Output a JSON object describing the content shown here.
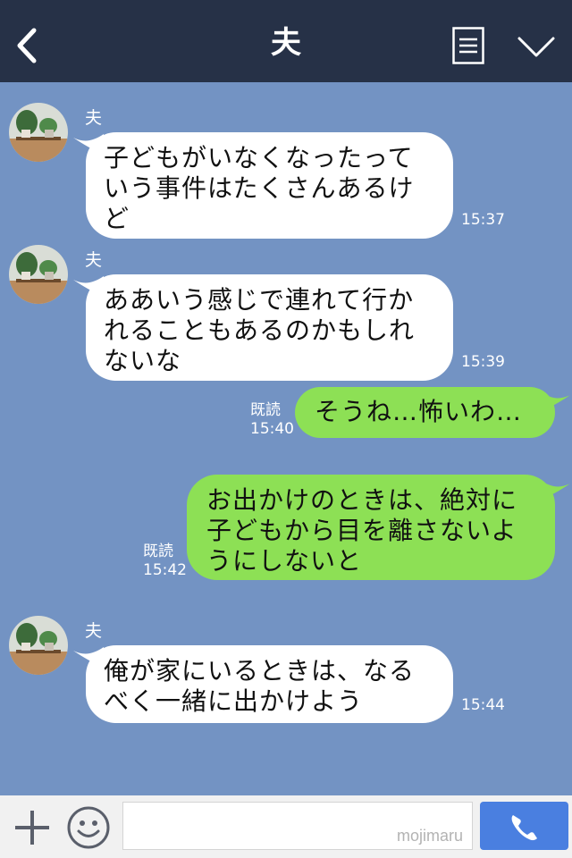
{
  "header": {
    "title": "夫"
  },
  "messages": [
    {
      "side": "in",
      "sender": "夫",
      "lines": [
        "子どもがいなくなったって",
        "いう事件はたくさんあるけ",
        "ど"
      ],
      "time": "15:37"
    },
    {
      "side": "in",
      "sender": "夫",
      "lines": [
        "ああいう感じで連れて行か",
        "れることもあるのかもしれ",
        "ないな"
      ],
      "time": "15:39"
    },
    {
      "side": "out",
      "read": "既読",
      "lines": [
        "そうね…怖いわ…"
      ],
      "time": "15:40"
    },
    {
      "side": "out",
      "read": "既読",
      "lines": [
        "お出かけのときは、絶対に",
        "子どもから目を離さないよ",
        "うにしないと"
      ],
      "time": "15:42"
    },
    {
      "side": "in",
      "sender": "夫",
      "lines": [
        "俺が家にいるときは、なる",
        "べく一緒に出かけよう"
      ],
      "time": "15:44"
    }
  ],
  "footer": {
    "watermark": "mojimaru"
  },
  "colors": {
    "header": "#263147",
    "chat_bg": "#7393c3",
    "incoming": "#ffffff",
    "outgoing": "#8de055",
    "call_button": "#4a7fe0"
  },
  "icons": {
    "back": "chevron-left-icon",
    "menu": "menu-list-icon",
    "collapse": "chevron-down-icon",
    "add": "plus-icon",
    "sticker": "smiley-icon",
    "call": "phone-icon"
  }
}
